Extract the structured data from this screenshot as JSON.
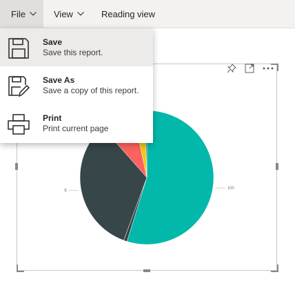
{
  "menubar": {
    "file_label": "File",
    "view_label": "View",
    "reading_view_label": "Reading view"
  },
  "file_menu": {
    "items": [
      {
        "title": "Save",
        "subtitle": "Save this report.",
        "icon": "floppy-disk-icon"
      },
      {
        "title": "Save As",
        "subtitle": "Save a copy of this report.",
        "icon": "floppy-disk-pencil-icon"
      },
      {
        "title": "Print",
        "subtitle": "Print current page",
        "icon": "printer-icon"
      }
    ]
  },
  "visual_header": {
    "icons": [
      "pin-icon",
      "focus-mode-icon",
      "more-options-icon"
    ]
  },
  "chart_data": {
    "type": "pie",
    "slices": [
      {
        "label": "100",
        "value": 100,
        "color": "#01b8aa"
      },
      {
        "label": "",
        "value": 1.5,
        "color": "#374649"
      },
      {
        "label": "6",
        "value": 60,
        "color": "#374649"
      },
      {
        "label": "",
        "value": 15,
        "color": "#fd625e"
      },
      {
        "label": "",
        "value": 5,
        "color": "#f2c80f"
      },
      {
        "label": "",
        "value": 1,
        "color": "#5f6b6d"
      }
    ],
    "data_labels": [
      "100",
      "6"
    ],
    "colors": {
      "teal": "#01b8aa",
      "dark": "#374649",
      "red": "#fd625e",
      "yellow": "#f2c80f"
    }
  }
}
